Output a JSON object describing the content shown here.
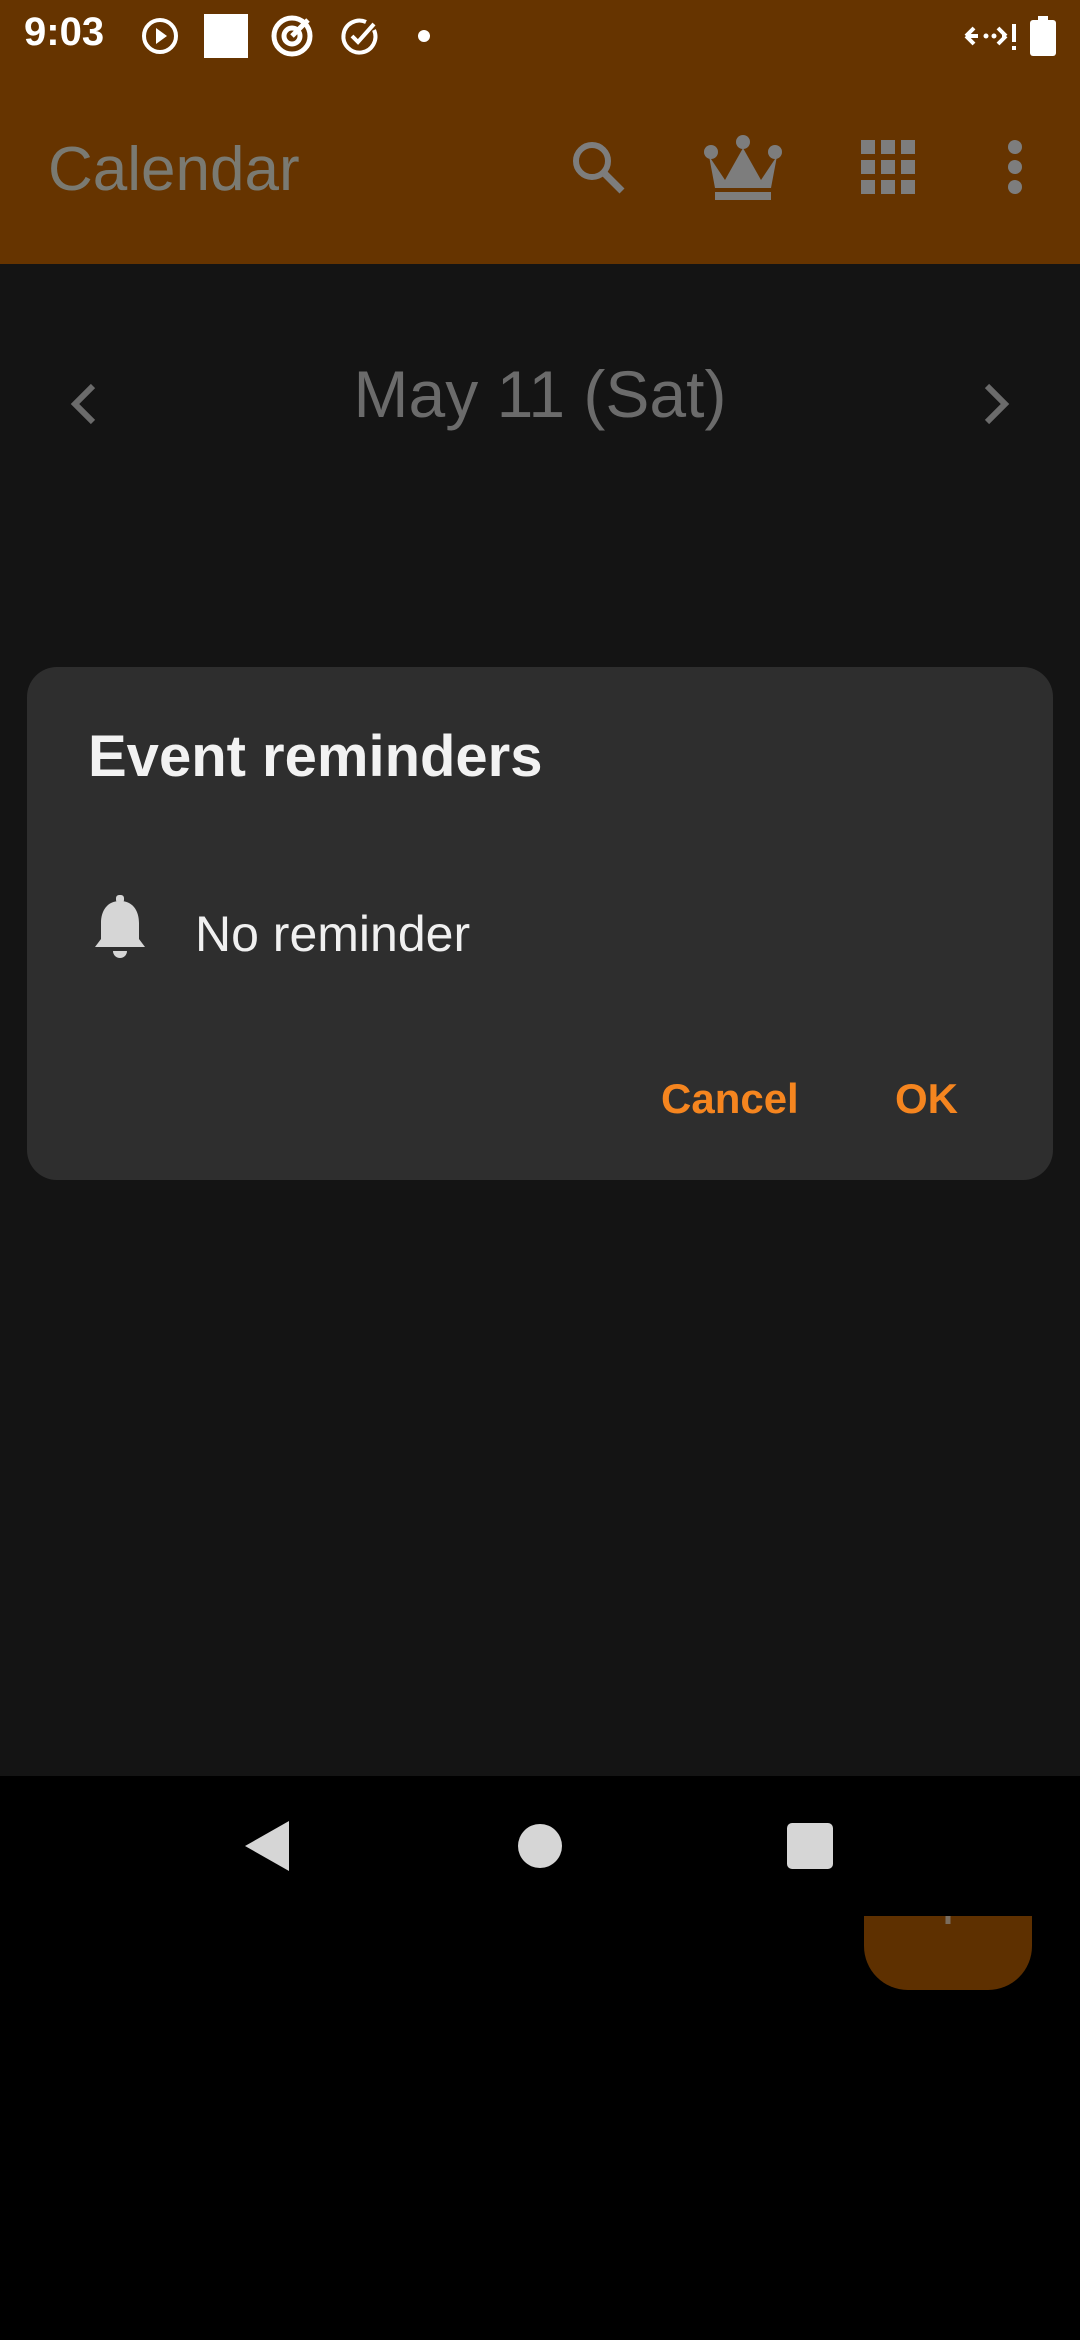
{
  "status_bar": {
    "time": "9:03",
    "icons": [
      "play-circle-icon",
      "square-icon",
      "target-icon",
      "check-circle-icon",
      "dot-icon"
    ],
    "right_icons": [
      "data-arrows-icon",
      "battery-icon"
    ]
  },
  "app_bar": {
    "title": "Calendar",
    "actions": [
      "search-icon",
      "crown-icon",
      "grid-icon",
      "more-vert-icon"
    ],
    "background": "#663400"
  },
  "date_nav": {
    "label": "May 11 (Sat)"
  },
  "dialog": {
    "title": "Event reminders",
    "reminder_label": "No reminder",
    "cancel_label": "Cancel",
    "ok_label": "OK",
    "accent": "#f5851f"
  },
  "fab": {
    "icon": "plus-icon"
  },
  "nav_bar": {
    "buttons": [
      "back-icon",
      "home-icon",
      "recents-icon"
    ]
  }
}
